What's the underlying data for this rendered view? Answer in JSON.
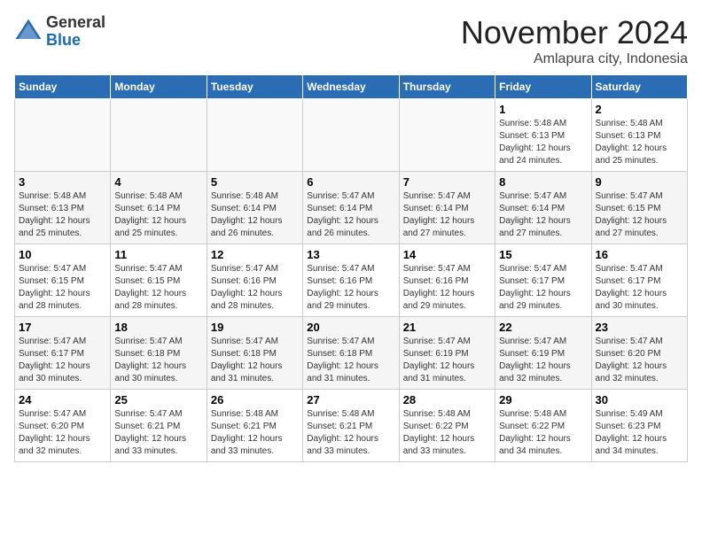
{
  "logo": {
    "general": "General",
    "blue": "Blue"
  },
  "header": {
    "month_year": "November 2024",
    "location": "Amlapura city, Indonesia"
  },
  "weekdays": [
    "Sunday",
    "Monday",
    "Tuesday",
    "Wednesday",
    "Thursday",
    "Friday",
    "Saturday"
  ],
  "weeks": [
    [
      {
        "day": "",
        "info": ""
      },
      {
        "day": "",
        "info": ""
      },
      {
        "day": "",
        "info": ""
      },
      {
        "day": "",
        "info": ""
      },
      {
        "day": "",
        "info": ""
      },
      {
        "day": "1",
        "info": "Sunrise: 5:48 AM\nSunset: 6:13 PM\nDaylight: 12 hours\nand 24 minutes."
      },
      {
        "day": "2",
        "info": "Sunrise: 5:48 AM\nSunset: 6:13 PM\nDaylight: 12 hours\nand 25 minutes."
      }
    ],
    [
      {
        "day": "3",
        "info": "Sunrise: 5:48 AM\nSunset: 6:13 PM\nDaylight: 12 hours\nand 25 minutes."
      },
      {
        "day": "4",
        "info": "Sunrise: 5:48 AM\nSunset: 6:14 PM\nDaylight: 12 hours\nand 25 minutes."
      },
      {
        "day": "5",
        "info": "Sunrise: 5:48 AM\nSunset: 6:14 PM\nDaylight: 12 hours\nand 26 minutes."
      },
      {
        "day": "6",
        "info": "Sunrise: 5:47 AM\nSunset: 6:14 PM\nDaylight: 12 hours\nand 26 minutes."
      },
      {
        "day": "7",
        "info": "Sunrise: 5:47 AM\nSunset: 6:14 PM\nDaylight: 12 hours\nand 27 minutes."
      },
      {
        "day": "8",
        "info": "Sunrise: 5:47 AM\nSunset: 6:14 PM\nDaylight: 12 hours\nand 27 minutes."
      },
      {
        "day": "9",
        "info": "Sunrise: 5:47 AM\nSunset: 6:15 PM\nDaylight: 12 hours\nand 27 minutes."
      }
    ],
    [
      {
        "day": "10",
        "info": "Sunrise: 5:47 AM\nSunset: 6:15 PM\nDaylight: 12 hours\nand 28 minutes."
      },
      {
        "day": "11",
        "info": "Sunrise: 5:47 AM\nSunset: 6:15 PM\nDaylight: 12 hours\nand 28 minutes."
      },
      {
        "day": "12",
        "info": "Sunrise: 5:47 AM\nSunset: 6:16 PM\nDaylight: 12 hours\nand 28 minutes."
      },
      {
        "day": "13",
        "info": "Sunrise: 5:47 AM\nSunset: 6:16 PM\nDaylight: 12 hours\nand 29 minutes."
      },
      {
        "day": "14",
        "info": "Sunrise: 5:47 AM\nSunset: 6:16 PM\nDaylight: 12 hours\nand 29 minutes."
      },
      {
        "day": "15",
        "info": "Sunrise: 5:47 AM\nSunset: 6:17 PM\nDaylight: 12 hours\nand 29 minutes."
      },
      {
        "day": "16",
        "info": "Sunrise: 5:47 AM\nSunset: 6:17 PM\nDaylight: 12 hours\nand 30 minutes."
      }
    ],
    [
      {
        "day": "17",
        "info": "Sunrise: 5:47 AM\nSunset: 6:17 PM\nDaylight: 12 hours\nand 30 minutes."
      },
      {
        "day": "18",
        "info": "Sunrise: 5:47 AM\nSunset: 6:18 PM\nDaylight: 12 hours\nand 30 minutes."
      },
      {
        "day": "19",
        "info": "Sunrise: 5:47 AM\nSunset: 6:18 PM\nDaylight: 12 hours\nand 31 minutes."
      },
      {
        "day": "20",
        "info": "Sunrise: 5:47 AM\nSunset: 6:18 PM\nDaylight: 12 hours\nand 31 minutes."
      },
      {
        "day": "21",
        "info": "Sunrise: 5:47 AM\nSunset: 6:19 PM\nDaylight: 12 hours\nand 31 minutes."
      },
      {
        "day": "22",
        "info": "Sunrise: 5:47 AM\nSunset: 6:19 PM\nDaylight: 12 hours\nand 32 minutes."
      },
      {
        "day": "23",
        "info": "Sunrise: 5:47 AM\nSunset: 6:20 PM\nDaylight: 12 hours\nand 32 minutes."
      }
    ],
    [
      {
        "day": "24",
        "info": "Sunrise: 5:47 AM\nSunset: 6:20 PM\nDaylight: 12 hours\nand 32 minutes."
      },
      {
        "day": "25",
        "info": "Sunrise: 5:47 AM\nSunset: 6:21 PM\nDaylight: 12 hours\nand 33 minutes."
      },
      {
        "day": "26",
        "info": "Sunrise: 5:48 AM\nSunset: 6:21 PM\nDaylight: 12 hours\nand 33 minutes."
      },
      {
        "day": "27",
        "info": "Sunrise: 5:48 AM\nSunset: 6:21 PM\nDaylight: 12 hours\nand 33 minutes."
      },
      {
        "day": "28",
        "info": "Sunrise: 5:48 AM\nSunset: 6:22 PM\nDaylight: 12 hours\nand 33 minutes."
      },
      {
        "day": "29",
        "info": "Sunrise: 5:48 AM\nSunset: 6:22 PM\nDaylight: 12 hours\nand 34 minutes."
      },
      {
        "day": "30",
        "info": "Sunrise: 5:49 AM\nSunset: 6:23 PM\nDaylight: 12 hours\nand 34 minutes."
      }
    ]
  ]
}
